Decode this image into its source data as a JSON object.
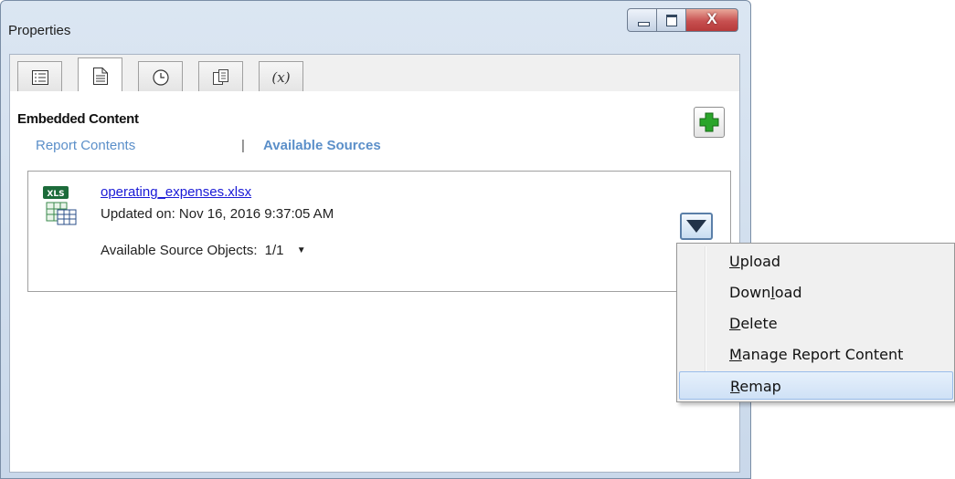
{
  "window": {
    "title": "Properties",
    "controls": {
      "minimize_icon": "minimize-icon",
      "maximize_icon": "maximize-icon",
      "close_label": "X"
    }
  },
  "tabs": [
    {
      "icon": "list-icon",
      "active": false
    },
    {
      "icon": "document-icon",
      "active": true
    },
    {
      "icon": "clock-icon",
      "active": false
    },
    {
      "icon": "document-copy-icon",
      "active": false
    },
    {
      "icon": "variable-icon",
      "label": "(x)",
      "active": false
    }
  ],
  "panel": {
    "title": "Embedded Content",
    "links": {
      "report_contents": "Report Contents",
      "separator": "|",
      "available_sources": "Available Sources"
    },
    "add_button_icon": "plus-icon"
  },
  "source": {
    "file_badge": "XLS",
    "file_name": "operating_expenses.xlsx",
    "updated": "Updated on: Nov 16, 2016 9:37:05 AM",
    "available_label": "Available Source Objects:",
    "available_value": "1/1"
  },
  "menu": {
    "items": [
      {
        "pre": "",
        "key": "U",
        "post": "pload"
      },
      {
        "pre": "Down",
        "key": "l",
        "post": "oad"
      },
      {
        "pre": "",
        "key": "D",
        "post": "elete"
      },
      {
        "pre": "",
        "key": "M",
        "post": "anage Report Content"
      },
      {
        "pre": "",
        "key": "R",
        "post": "emap",
        "highlighted": true
      }
    ]
  },
  "colors": {
    "link": "#5b8fc9",
    "file_link": "#1a1ad6",
    "highlight": "#cfe1f6",
    "add_plus": "#2aa52a"
  }
}
